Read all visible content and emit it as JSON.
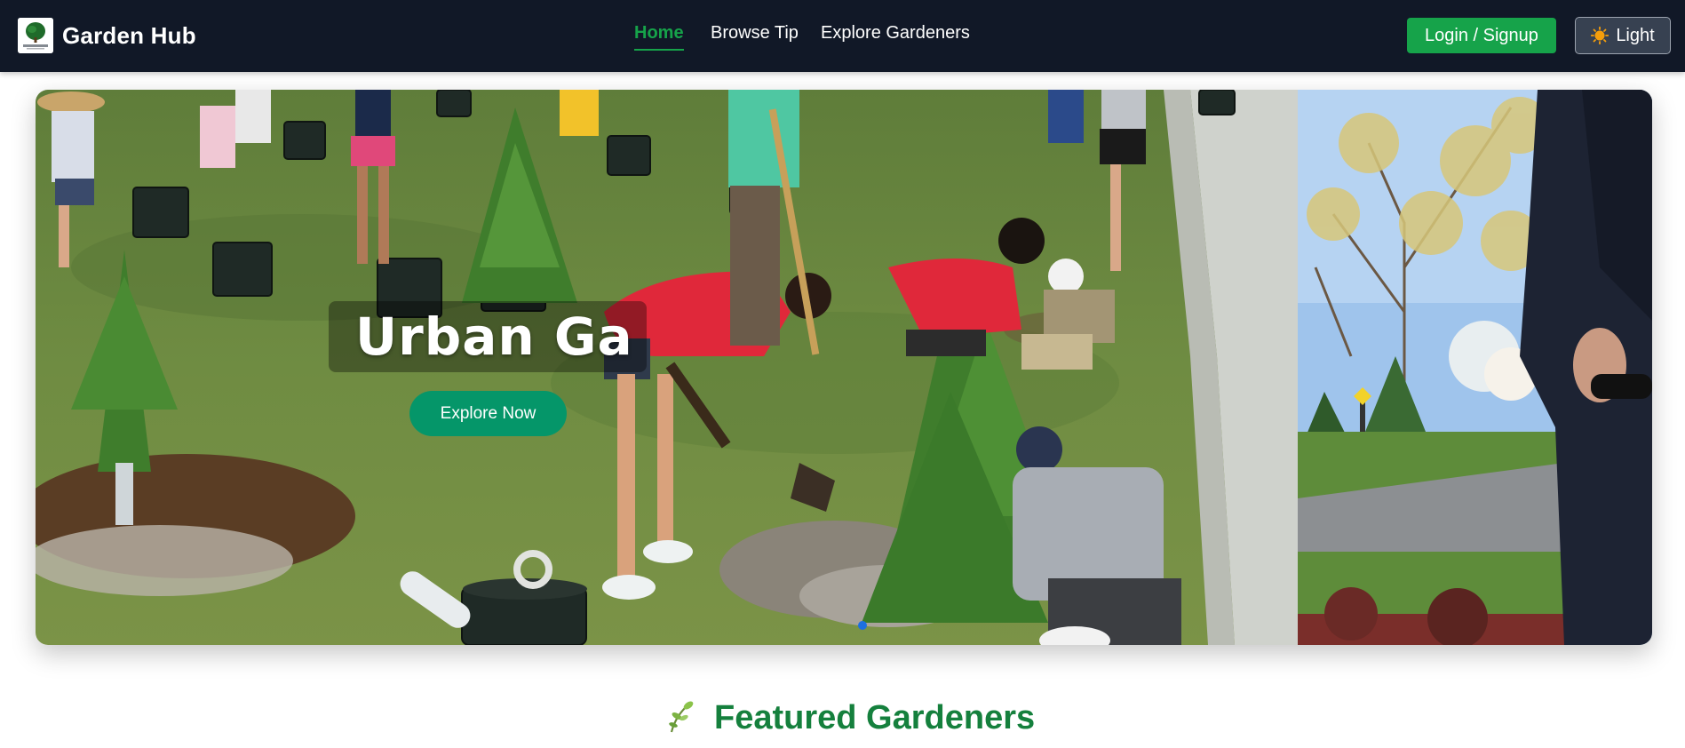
{
  "navbar": {
    "brand": {
      "name": "Garden Hub",
      "logo_text": "Garden Hub"
    },
    "links": [
      {
        "label": "Home",
        "active": true
      },
      {
        "label": "Browse Tip",
        "active": false
      },
      {
        "label": "Explore Gardeners",
        "active": false
      }
    ],
    "login_label": "Login / Signup",
    "theme_label": "Light",
    "theme_icon": "sun-icon"
  },
  "hero": {
    "title": "Urban Ga",
    "cta_label": "Explore Now",
    "active_slide_indicator": 1
  },
  "featured": {
    "title": "Featured Gardeners",
    "icon": "sprout-icon"
  },
  "colors": {
    "navbar_bg": "#111827",
    "accent_green": "#16a34a",
    "cta_green": "#059669",
    "heading_green": "#15803d",
    "dot_blue": "#1d6fe0"
  }
}
